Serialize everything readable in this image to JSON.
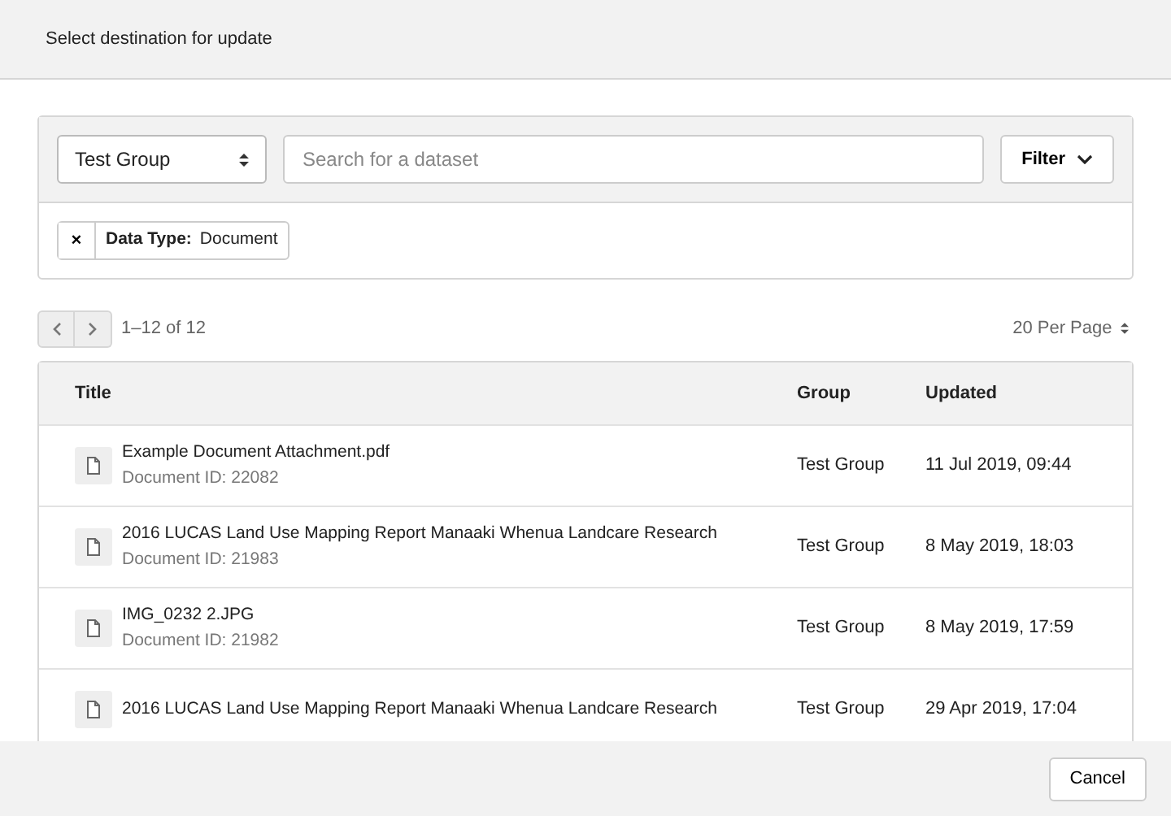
{
  "window": {
    "title": "Select destination for update"
  },
  "toolbar": {
    "group_select": {
      "value": "Test Group"
    },
    "search": {
      "placeholder": "Search for a dataset"
    },
    "filter_button": {
      "label": "Filter"
    }
  },
  "active_filters": [
    {
      "remove": "×",
      "label": "Data Type:",
      "value": "Document"
    }
  ],
  "pagination": {
    "range": "1–12 of 12",
    "per_page": "20 Per Page"
  },
  "table": {
    "columns": [
      "Title",
      "Group",
      "Updated"
    ],
    "rows": [
      {
        "title": "Example Document Attachment.pdf",
        "subtitle": "Document ID: 22082",
        "group": "Test Group",
        "updated": "11 Jul 2019, 09:44"
      },
      {
        "title": "2016 LUCAS Land Use Mapping Report Manaaki Whenua Landcare Research",
        "subtitle": "Document ID: 21983",
        "group": "Test Group",
        "updated": "8 May 2019, 18:03"
      },
      {
        "title": "IMG_0232 2.JPG",
        "subtitle": "Document ID: 21982",
        "group": "Test Group",
        "updated": "8 May 2019, 17:59"
      },
      {
        "title": "2016 LUCAS Land Use Mapping Report Manaaki Whenua Landcare Research",
        "group": "Test Group",
        "updated": "29 Apr 2019, 17:04"
      }
    ]
  },
  "footer": {
    "cancel": "Cancel"
  }
}
